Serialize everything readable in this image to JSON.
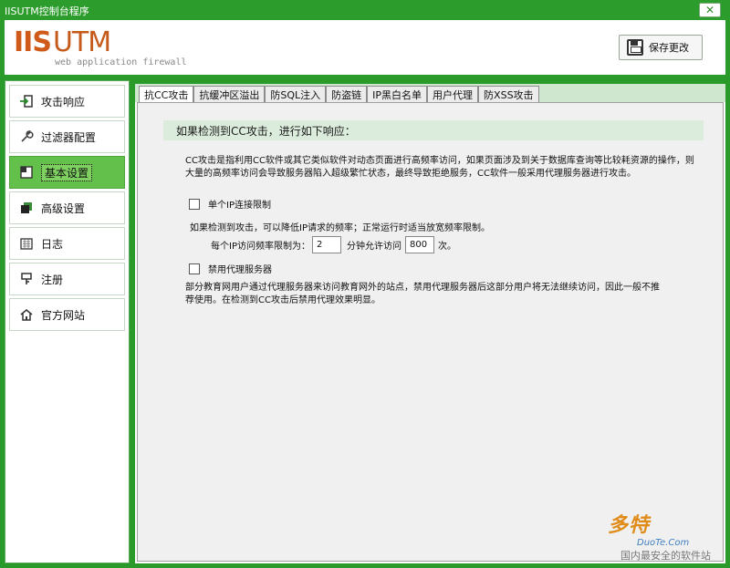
{
  "window": {
    "title": "IISUTM控制台程序",
    "close_label": "✕"
  },
  "header": {
    "logo_mark_iis": "IIS",
    "logo_mark_utm": "UTM",
    "logo_sub": "web application firewall",
    "save_label": "保存更改"
  },
  "sidebar": {
    "items": [
      {
        "label": "攻击响应",
        "icon": "arrow-in-icon"
      },
      {
        "label": "过滤器配置",
        "icon": "wrench-icon"
      },
      {
        "label": "基本设置",
        "icon": "window-icon"
      },
      {
        "label": "高级设置",
        "icon": "layers-icon"
      },
      {
        "label": "日志",
        "icon": "calendar-icon"
      },
      {
        "label": "注册",
        "icon": "key-icon"
      },
      {
        "label": "官方网站",
        "icon": "home-icon"
      }
    ],
    "active_index": 2
  },
  "tabs": [
    {
      "label": "抗CC攻击"
    },
    {
      "label": "抗缓冲区溢出"
    },
    {
      "label": "防SQL注入"
    },
    {
      "label": "防盗链"
    },
    {
      "label": "IP黑白名单"
    },
    {
      "label": "用户代理"
    },
    {
      "label": "防XSS攻击"
    }
  ],
  "content": {
    "section_title": "如果检测到CC攻击，进行如下响应：",
    "description": "CC攻击是指利用CC软件或其它类似软件对动态页面进行高频率访问，如果页面涉及到关于数据库查询等比较耗资源的操作，则大量的高频率访问会导致服务器陷入超级繁忙状态，最终导致拒绝服务，CC软件一般采用代理服务器进行攻击。",
    "single_ip_label": "单个IP连接限制",
    "single_ip_checked": false,
    "rate_note": "如果检测到攻击，可以降低IP请求的频率；正常运行时适当放宽频率限制。",
    "rate_prefix": "每个IP访问频率限制为：",
    "rate_minutes": "2",
    "rate_middle": "分钟允许访问",
    "rate_count": "800",
    "rate_suffix": "次。",
    "proxy_label": "禁用代理服务器",
    "proxy_checked": false,
    "proxy_note": "部分教育网用户通过代理服务器来访问教育网外的站点，禁用代理服务器后这部分用户将无法继续访问，因此一般不推荐使用。在检测到CC攻击后禁用代理效果明显。"
  },
  "watermark": {
    "logo": "多特",
    "sub": "DuoTe.Com",
    "text": "国内最安全的软件站"
  },
  "colors": {
    "frame_green": "#2a9a2a",
    "active_nav": "#63c04a",
    "section_bar": "#dcecdc"
  }
}
